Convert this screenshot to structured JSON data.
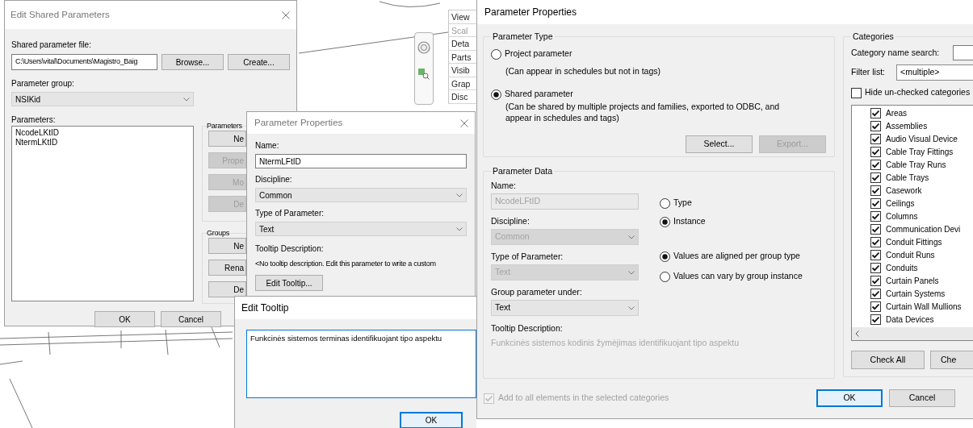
{
  "background": {
    "property_rows": [
      {
        "label": "View",
        "disabled": false
      },
      {
        "label": "Scal",
        "disabled": true
      },
      {
        "label": "Deta",
        "disabled": false
      },
      {
        "label": "Parts",
        "disabled": false
      },
      {
        "label": "Visib",
        "disabled": false
      },
      {
        "label": "Grap",
        "disabled": false
      },
      {
        "label": "Disc",
        "disabled": false
      }
    ]
  },
  "edit_shared_parameters": {
    "title": "Edit Shared Parameters",
    "file_label": "Shared parameter file:",
    "file_path": "C:\\Users\\vital\\Documents\\Magistro_Baig",
    "file_buttons": [
      "Browse...",
      "Create..."
    ],
    "group_label": "Parameter group:",
    "group_value": "NSIKid",
    "parameters_label": "Parameters:",
    "parameters": [
      "NcodeLKtID",
      "NtermLKtID"
    ],
    "side_groups": [
      {
        "title": "Parameters",
        "buttons": [
          {
            "label": "Ne",
            "disabled": false
          },
          {
            "label": "Prope",
            "disabled": true
          },
          {
            "label": "Mo",
            "disabled": true
          },
          {
            "label": "De",
            "disabled": true
          }
        ]
      },
      {
        "title": "Groups",
        "buttons": [
          {
            "label": "Ne",
            "disabled": false
          },
          {
            "label": "Rena",
            "disabled": false
          },
          {
            "label": "De",
            "disabled": false
          }
        ]
      }
    ],
    "footer_buttons": [
      "OK",
      "Cancel"
    ]
  },
  "parameter_properties_small": {
    "title": "Parameter Properties",
    "fields": [
      {
        "label": "Name:",
        "value": "NtermLFtID",
        "kind": "text"
      },
      {
        "label": "Discipline:",
        "value": "Common",
        "kind": "select"
      },
      {
        "label": "Type of Parameter:",
        "value": "Text",
        "kind": "select"
      }
    ],
    "tooltip_label": "Tooltip Description:",
    "tooltip_text": "<No tooltip description. Edit this parameter to write a custom",
    "edit_tooltip_button": "Edit Tooltip..."
  },
  "edit_tooltip": {
    "title": "Edit Tooltip",
    "text": "Funkcinės sistemos terminas identifikuojant tipo aspektu",
    "ok_button": "OK"
  },
  "parameter_properties": {
    "title": "Parameter Properties",
    "parameter_type": {
      "title": "Parameter Type",
      "options": [
        {
          "label": "Project parameter",
          "notes": [
            "(Can appear in schedules but not in tags)"
          ],
          "selected": false
        },
        {
          "label": "Shared parameter",
          "notes": [
            "(Can be shared by multiple projects and families, exported to ODBC, and",
            "appear in schedules and tags)"
          ],
          "selected": true
        }
      ],
      "buttons": [
        {
          "label": "Select...",
          "disabled": false
        },
        {
          "label": "Export...",
          "disabled": true
        }
      ]
    },
    "parameter_data": {
      "title": "Parameter Data",
      "fields": [
        {
          "label": "Name:",
          "value": "NcodeLFtID",
          "kind": "text",
          "disabled": true
        },
        {
          "label": "Discipline:",
          "value": "Common",
          "kind": "select",
          "disabled": true
        },
        {
          "label": "Type of Parameter:",
          "value": "Text",
          "kind": "select",
          "disabled": true
        },
        {
          "label": "Group parameter under:",
          "value": "Text",
          "kind": "select",
          "disabled": false
        }
      ],
      "instance_options": [
        {
          "label": "Type",
          "selected": false
        },
        {
          "label": "Instance",
          "selected": true
        }
      ],
      "group_options": [
        {
          "label": "Values are aligned per group type",
          "selected": true
        },
        {
          "label": "Values can vary by group instance",
          "selected": false
        }
      ],
      "tooltip_label": "Tooltip Description:",
      "tooltip_text": "Funkcinės sistemos kodinis žymėjimas identifikuojant tipo aspektu"
    },
    "add_to_all": {
      "label": "Add to all elements in the selected categories",
      "checked": true,
      "disabled": true
    },
    "categories": {
      "title": "Categories",
      "search_label": "Category name search:",
      "filter_label": "Filter list:",
      "filter_value": "<multiple>",
      "hide_unchecked": {
        "label": "Hide un-checked categories",
        "checked": false
      },
      "items": [
        {
          "label": "Areas",
          "checked": true
        },
        {
          "label": "Assemblies",
          "checked": true
        },
        {
          "label": "Audio Visual Device",
          "checked": true
        },
        {
          "label": "Cable Tray Fittings",
          "checked": true
        },
        {
          "label": "Cable Tray Runs",
          "checked": true
        },
        {
          "label": "Cable Trays",
          "checked": true
        },
        {
          "label": "Casework",
          "checked": true
        },
        {
          "label": "Ceilings",
          "checked": true
        },
        {
          "label": "Columns",
          "checked": true
        },
        {
          "label": "Communication Devi",
          "checked": true
        },
        {
          "label": "Conduit Fittings",
          "checked": true
        },
        {
          "label": "Conduit Runs",
          "checked": true
        },
        {
          "label": "Conduits",
          "checked": true
        },
        {
          "label": "Curtain Panels",
          "checked": true
        },
        {
          "label": "Curtain Systems",
          "checked": true
        },
        {
          "label": "Curtain Wall Mullions",
          "checked": true
        },
        {
          "label": "Data Devices",
          "checked": true
        }
      ],
      "buttons": [
        "Check All",
        "Che"
      ]
    },
    "buttons": [
      {
        "label": "OK",
        "default": true
      },
      {
        "label": "Cancel",
        "default": false
      }
    ]
  }
}
